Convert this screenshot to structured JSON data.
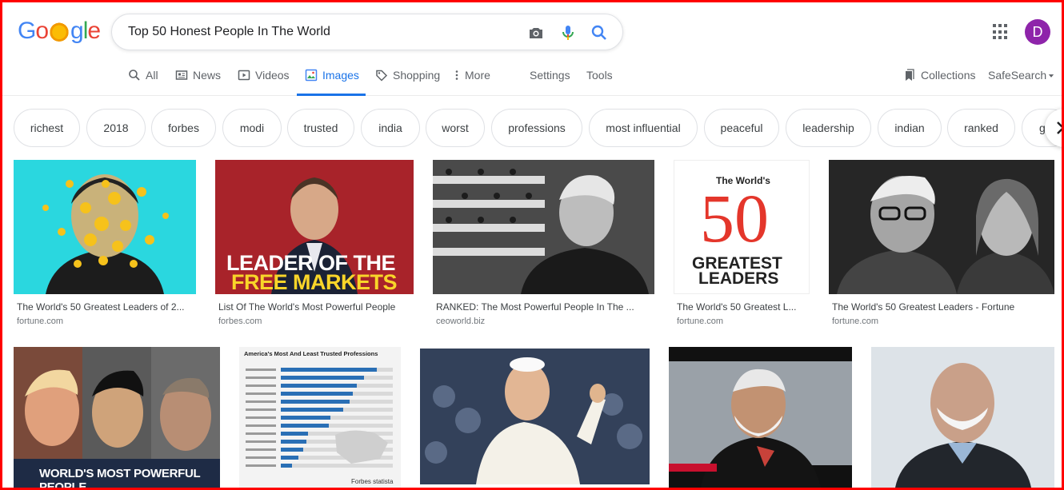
{
  "search": {
    "query": "Top 50 Honest People In The World"
  },
  "user": {
    "initial": "D"
  },
  "tabs": [
    {
      "label": "All"
    },
    {
      "label": "News"
    },
    {
      "label": "Videos"
    },
    {
      "label": "Images"
    },
    {
      "label": "Shopping"
    },
    {
      "label": "More"
    },
    {
      "label": "Settings"
    },
    {
      "label": "Tools"
    }
  ],
  "right_tools": {
    "collections": "Collections",
    "safesearch": "SafeSearch"
  },
  "chips": [
    "richest",
    "2018",
    "forbes",
    "modi",
    "trusted",
    "india",
    "worst",
    "professions",
    "most influential",
    "peaceful",
    "leadership",
    "indian",
    "ranked",
    "g"
  ],
  "results": [
    {
      "title": "The World's 50 Greatest Leaders of 2...",
      "source": "fortune.com"
    },
    {
      "title": "List Of The World's Most Powerful People",
      "source": "forbes.com",
      "overlay_line1": "LEADER OF THE",
      "overlay_line2": "FREE MARKETS"
    },
    {
      "title": "RANKED: The Most Powerful People In The ...",
      "source": "ceoworld.biz"
    },
    {
      "title": "The World's 50 Greatest L...",
      "source": "fortune.com",
      "overlay_top": "The World's",
      "overlay_num": "50",
      "overlay_line1": "GREATEST",
      "overlay_line2": "LEADERS"
    },
    {
      "title": "The World's 50 Greatest Leaders - Fortune",
      "source": "fortune.com"
    }
  ],
  "row2": [
    {
      "overlay": "WORLD'S MOST POWERFUL PEOPLE"
    },
    {
      "overlay": "America's Most And Least Trusted Professions",
      "footer": "Forbes statista"
    },
    {
      "overlay": ""
    },
    {
      "overlay": ""
    },
    {
      "overlay": ""
    }
  ],
  "colors": {
    "accent": "#1a73e8",
    "avatar": "#8e24aa",
    "frame": "#ff0000"
  }
}
